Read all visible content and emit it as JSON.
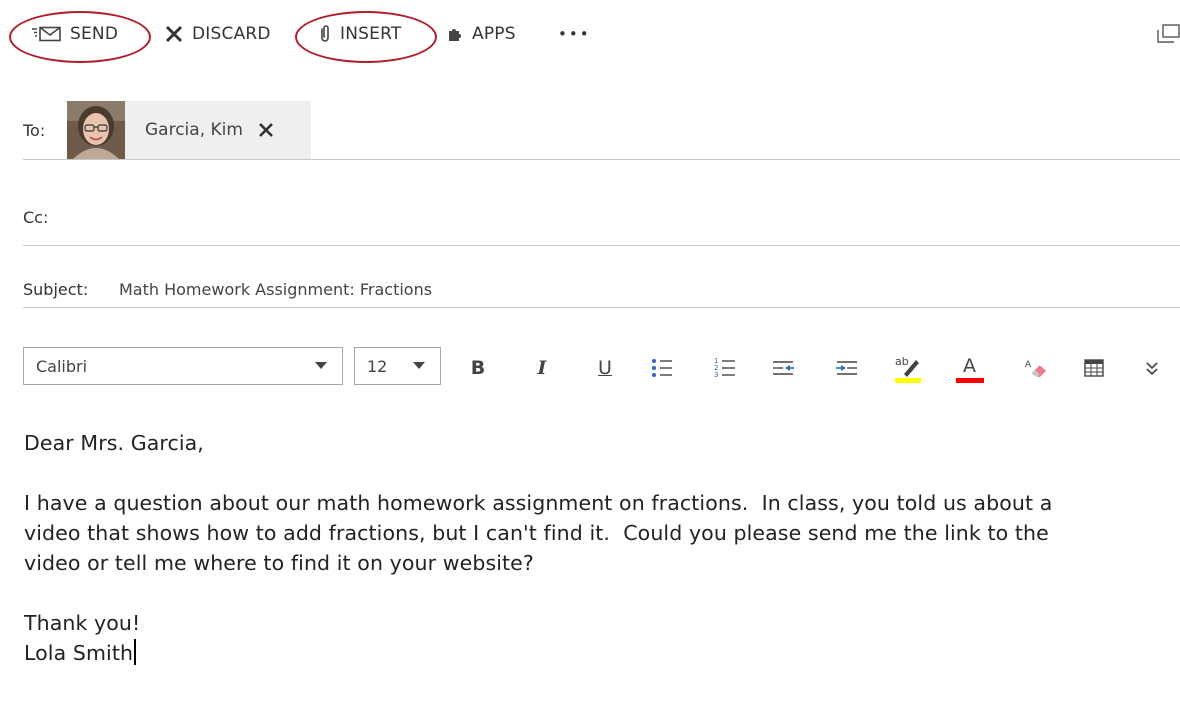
{
  "toolbar": {
    "send": "SEND",
    "discard": "DISCARD",
    "insert": "INSERT",
    "apps": "APPS",
    "more": "•••",
    "annotation_color": "#b01e2b"
  },
  "fields": {
    "to_label": "To:",
    "recipient_name": "Garcia, Kim",
    "cc_label": "Cc:",
    "subject_label": "Subject:",
    "subject_value": "Math Homework Assignment: Fractions"
  },
  "format": {
    "font_name": "Calibri",
    "font_size": "12",
    "bold": "B",
    "italic": "I",
    "underline": "U",
    "highlight_color": "#ffff00",
    "font_color": "#ff0000",
    "icons": [
      "bullets-icon",
      "numbering-icon",
      "decrease-indent-icon",
      "increase-indent-icon",
      "highlight-icon",
      "font-color-icon",
      "clear-format-icon",
      "table-icon",
      "expand-more-icon"
    ]
  },
  "body": {
    "greeting": "Dear Mrs. Garcia,",
    "line1": "I have a question about our math homework assignment on fractions.  In class, you told us about a",
    "line2": "video that shows how to add fractions, but I can't find it.  Could you please send me the link to the",
    "line3": "video or tell me where to find it on your website?",
    "closing": "Thank you!",
    "signature": "Lola Smith"
  }
}
